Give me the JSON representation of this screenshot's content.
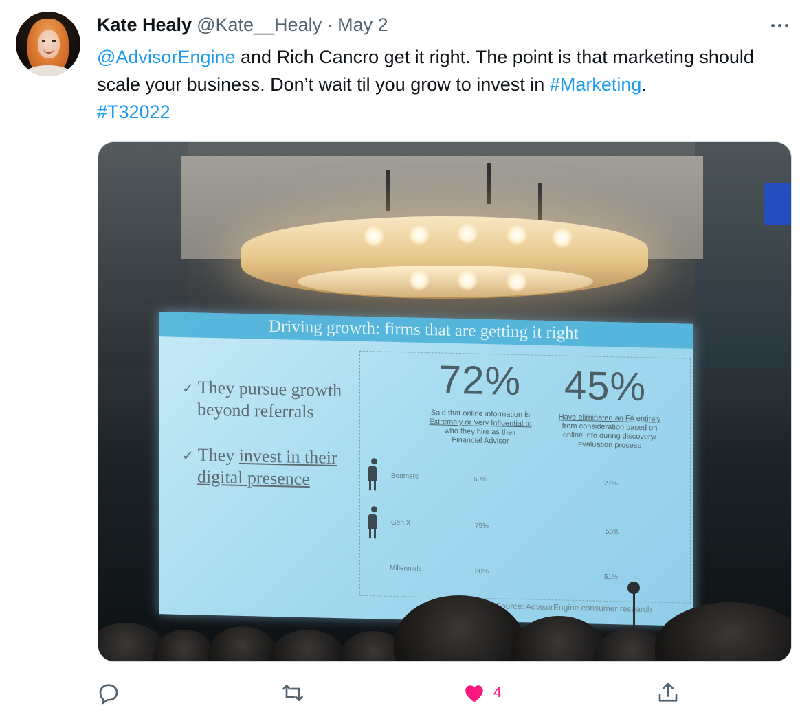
{
  "tweet": {
    "author_name": "Kate Healy",
    "author_handle": "@Kate__Healy",
    "separator": "·",
    "date": "May 2",
    "text_parts": {
      "mention": "@AdvisorEngine",
      "body": " and Rich Cancro get it right. The point is that marketing should scale your business. Don’t wait til you grow to invest in ",
      "hashtag1": "#Marketing",
      "period": ".",
      "hashtag2": "#T32022"
    }
  },
  "slide": {
    "title": "Driving growth: firms that are getting it right",
    "bullet1_line1": "They pursue growth",
    "bullet1_line2": "beyond referrals",
    "bullet2_prefix": "They ",
    "bullet2_underlined_line1": "invest in their",
    "bullet2_underlined_line2": "digital presence",
    "stat1_value": "72%",
    "stat1_desc_line1": "Said that online information is",
    "stat1_desc_line2": "Extremely or Very Influential to",
    "stat1_desc_line3": "who they hire as their",
    "stat1_desc_line4": "Financial Advisor",
    "stat2_value": "45%",
    "stat2_desc_line1": "Have eliminated an FA entirely",
    "stat2_desc_line2": "from consideration based on",
    "stat2_desc_line3": "online info during discovery/",
    "stat2_desc_line4": "evaluation process",
    "rows": [
      {
        "label": "Boomers",
        "v1": "60%",
        "v2": "27%"
      },
      {
        "label": "Gen X",
        "v1": "75%",
        "v2": "56%"
      },
      {
        "label": "Millennials",
        "v1": "80%",
        "v2": "51%"
      }
    ],
    "source": "Source: AdvisorEngine consumer research"
  },
  "actions": {
    "like_count": "4"
  },
  "icons": {
    "reply": "reply-icon",
    "retweet": "retweet-icon",
    "like": "heart-icon",
    "share": "share-icon",
    "more": "more-icon"
  },
  "colors": {
    "link": "#1d9bf0",
    "like": "#f91880",
    "secondary_text": "#536471"
  }
}
